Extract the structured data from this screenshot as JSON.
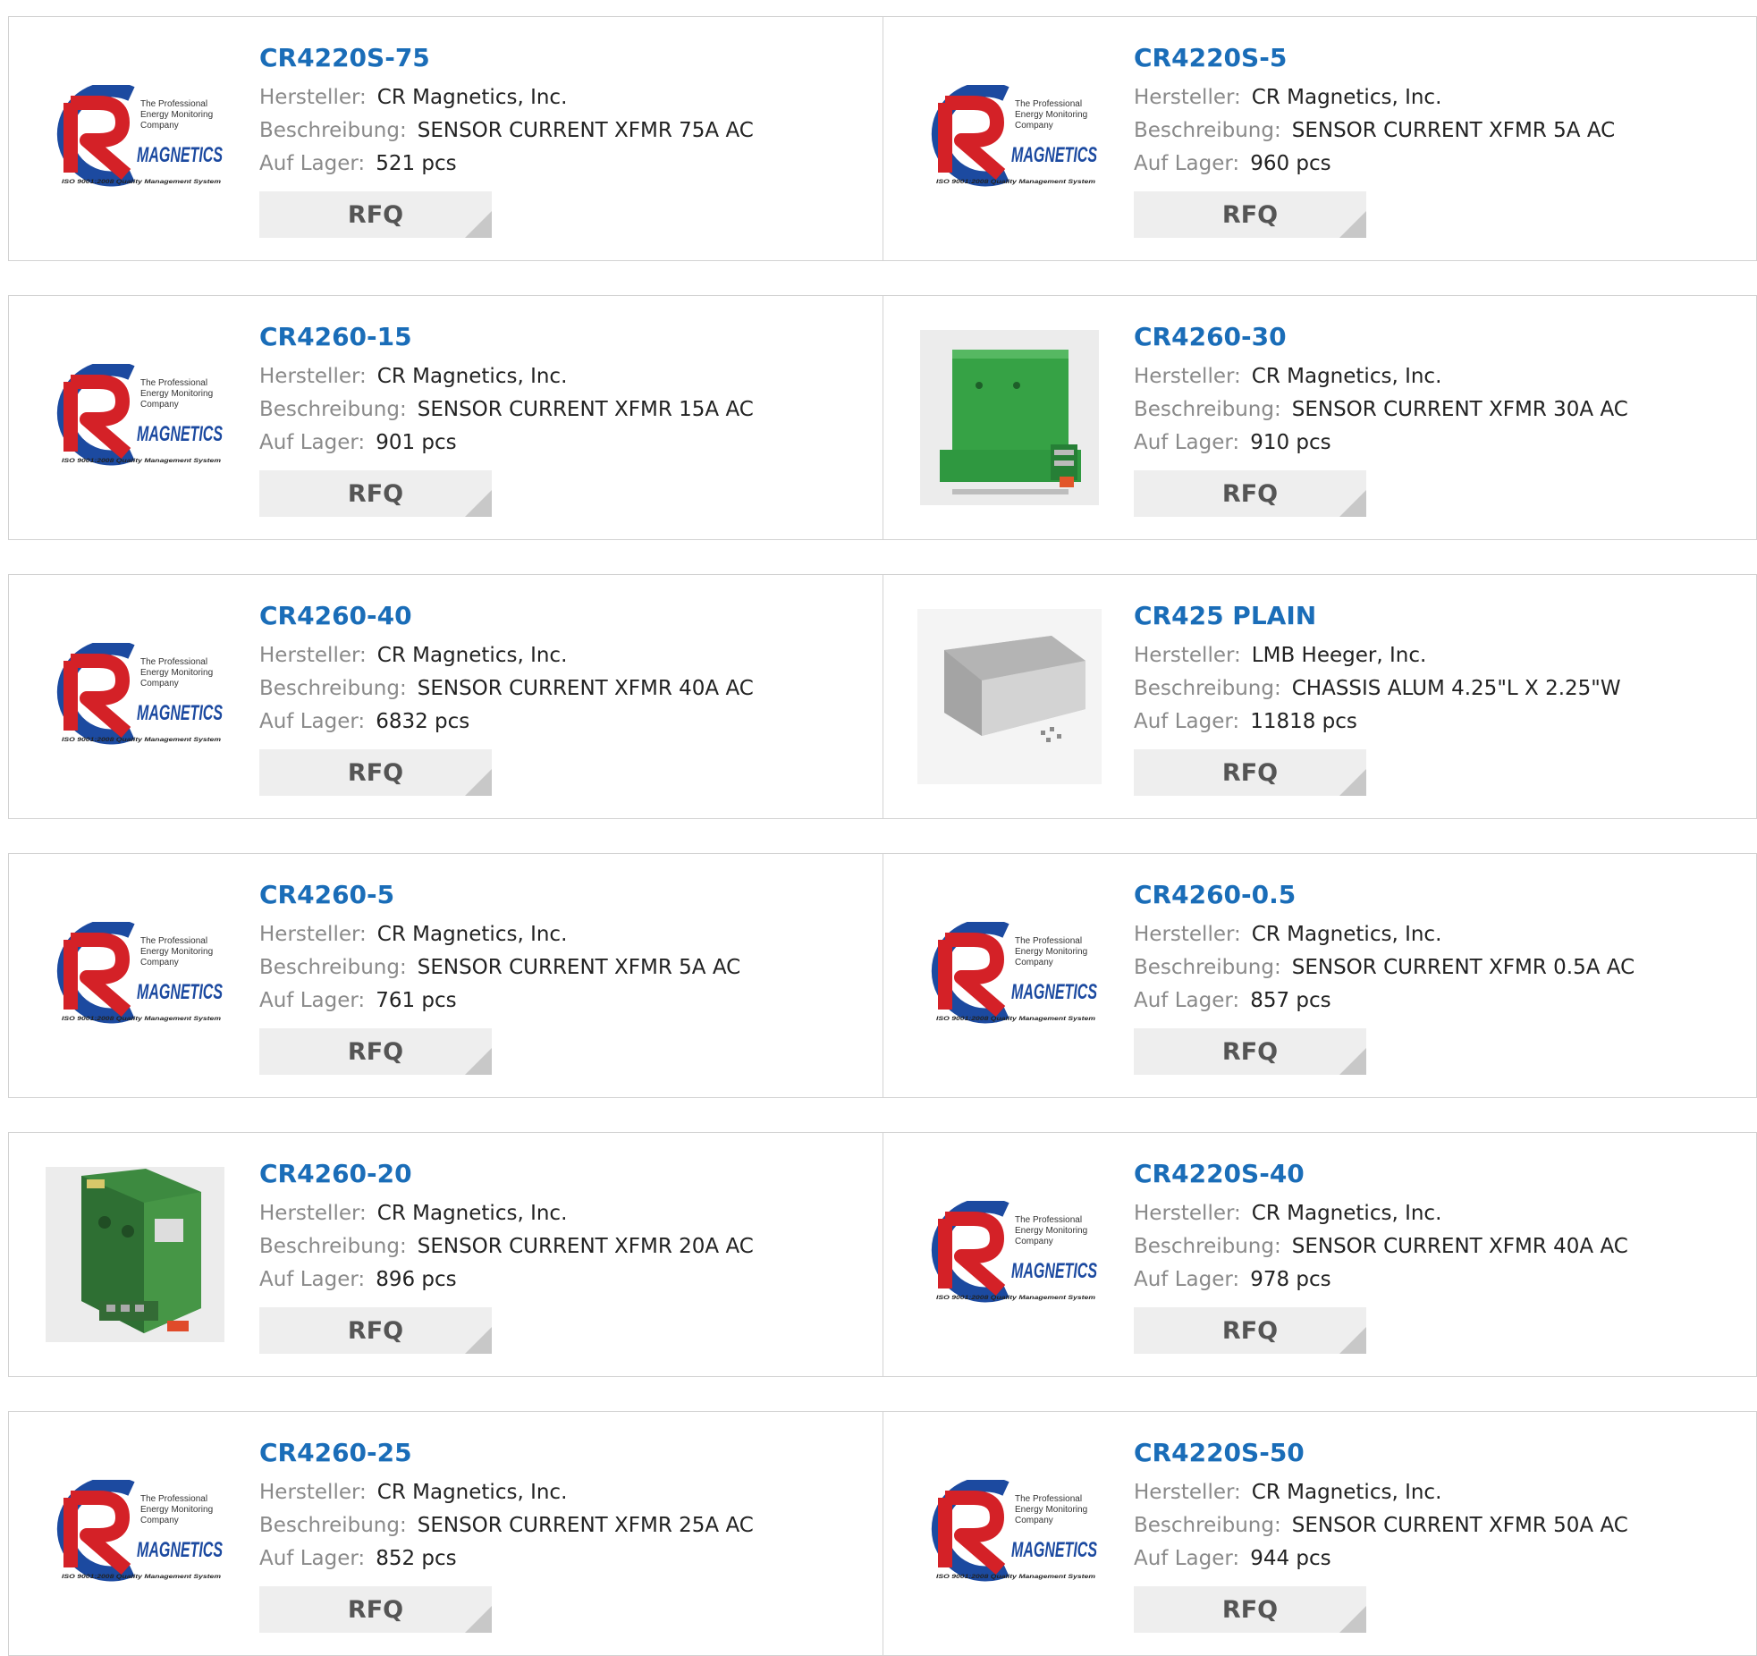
{
  "labels": {
    "manufacturer": "Hersteller:",
    "description": "Beschreibung:",
    "stock": "Auf Lager:",
    "rfq": "RFQ"
  },
  "logo": {
    "tagline_1": "The Professional",
    "tagline_2": "Energy Monitoring",
    "tagline_3": "Company",
    "wordmark": "MAGNETICS",
    "iso": "ISO 9001:2008 Quality Management System"
  },
  "products": [
    {
      "part": "CR4220S-75",
      "manufacturer": "CR Magnetics, Inc.",
      "description": "SENSOR CURRENT XFMR 75A AC",
      "stock": "521 pcs",
      "image": "cr-magnetics-logo"
    },
    {
      "part": "CR4220S-5",
      "manufacturer": "CR Magnetics, Inc.",
      "description": "SENSOR CURRENT XFMR 5A AC",
      "stock": "960 pcs",
      "image": "cr-magnetics-logo"
    },
    {
      "part": "CR4260-15",
      "manufacturer": "CR Magnetics, Inc.",
      "description": "SENSOR CURRENT XFMR 15A AC",
      "stock": "901 pcs",
      "image": "cr-magnetics-logo"
    },
    {
      "part": "CR4260-30",
      "manufacturer": "CR Magnetics, Inc.",
      "description": "SENSOR CURRENT XFMR 30A AC",
      "stock": "910 pcs",
      "image": "green-sensor-front"
    },
    {
      "part": "CR4260-40",
      "manufacturer": "CR Magnetics, Inc.",
      "description": "SENSOR CURRENT XFMR 40A AC",
      "stock": "6832 pcs",
      "image": "cr-magnetics-logo"
    },
    {
      "part": "CR425 PLAIN",
      "manufacturer": "LMB Heeger, Inc.",
      "description": "CHASSIS ALUM 4.25\"L X 2.25\"W",
      "stock": "11818 pcs",
      "image": "aluminum-chassis"
    },
    {
      "part": "CR4260-5",
      "manufacturer": "CR Magnetics, Inc.",
      "description": "SENSOR CURRENT XFMR 5A AC",
      "stock": "761 pcs",
      "image": "cr-magnetics-logo"
    },
    {
      "part": "CR4260-0.5",
      "manufacturer": "CR Magnetics, Inc.",
      "description": "SENSOR CURRENT XFMR 0.5A AC",
      "stock": "857 pcs",
      "image": "cr-magnetics-logo"
    },
    {
      "part": "CR4260-20",
      "manufacturer": "CR Magnetics, Inc.",
      "description": "SENSOR CURRENT XFMR 20A AC",
      "stock": "896 pcs",
      "image": "green-sensor-angled"
    },
    {
      "part": "CR4220S-40",
      "manufacturer": "CR Magnetics, Inc.",
      "description": "SENSOR CURRENT XFMR 40A AC",
      "stock": "978 pcs",
      "image": "cr-magnetics-logo"
    },
    {
      "part": "CR4260-25",
      "manufacturer": "CR Magnetics, Inc.",
      "description": "SENSOR CURRENT XFMR 25A AC",
      "stock": "852 pcs",
      "image": "cr-magnetics-logo"
    },
    {
      "part": "CR4220S-50",
      "manufacturer": "CR Magnetics, Inc.",
      "description": "SENSOR CURRENT XFMR 50A AC",
      "stock": "944 pcs",
      "image": "cr-magnetics-logo"
    }
  ],
  "colors": {
    "part_link": "#1a6db8",
    "label": "#8a8a8a",
    "rfq_bg": "#eeeeee",
    "logo_red": "#d42127",
    "logo_blue": "#1c4aa0"
  }
}
